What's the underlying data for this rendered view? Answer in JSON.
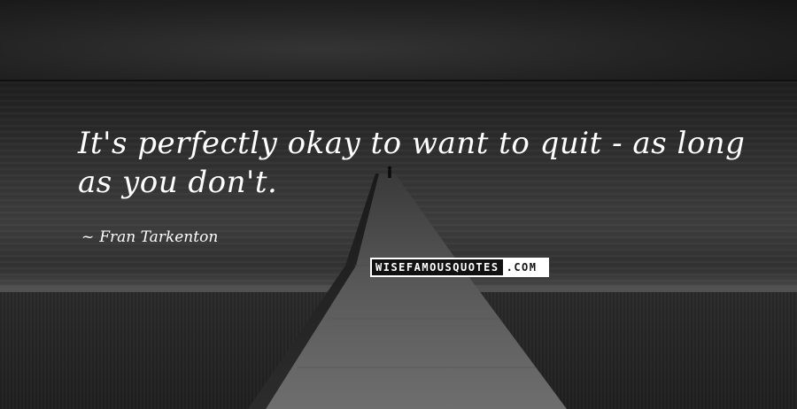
{
  "quote": {
    "line1": "It's perfectly okay to want to quit - as long",
    "line2": "as you don't."
  },
  "author": {
    "dash": "~",
    "name": "Fran Tarkenton"
  },
  "brand": {
    "left": "WISEFAMOUSQUOTES",
    "right": ".COM"
  }
}
